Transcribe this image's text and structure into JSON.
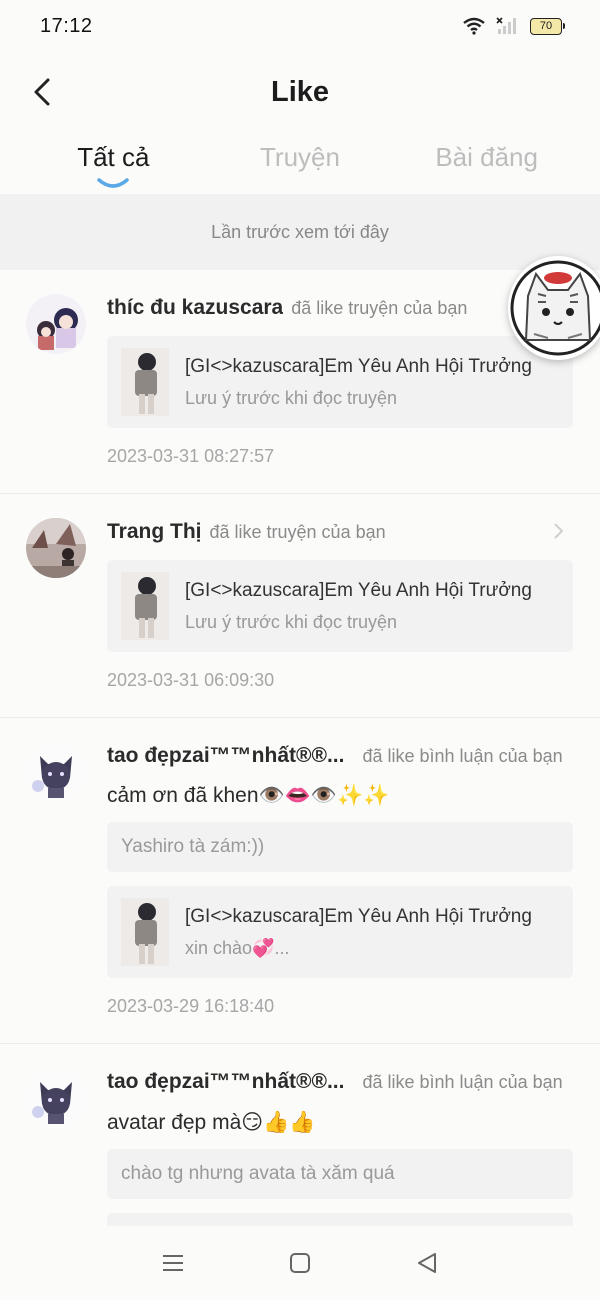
{
  "status_bar": {
    "time": "17:12",
    "battery": "70"
  },
  "header": {
    "title": "Like",
    "back_icon": "chevron-left-icon"
  },
  "tabs": [
    {
      "label": "Tất cả",
      "active": true
    },
    {
      "label": "Truyện",
      "active": false
    },
    {
      "label": "Bài đăng",
      "active": false
    }
  ],
  "notice": "Lần trước xem tới đây",
  "items": [
    {
      "user": "thíc đu kazuscara",
      "action": "đã like truyện của bạn",
      "story_title": "[GI<>kazuscara]Em Yêu Anh Hội Trưởng",
      "story_sub": "Lưu ý trước khi đọc truyện",
      "timestamp": "2023-03-31 08:27:57"
    },
    {
      "user": "Trang Thị",
      "action": "đã like truyện của bạn",
      "story_title": "[GI<>kazuscara]Em Yêu Anh Hội Trưởng",
      "story_sub": "Lưu ý trước khi đọc truyện",
      "timestamp": "2023-03-31 06:09:30"
    },
    {
      "user": "tao đẹpzai™™nhất®®...",
      "action": "đã like bình luận của bạn",
      "comment": "cảm ơn đã khen👁️👄👁️✨✨",
      "quote": "Yashiro tà zám:))",
      "story_title": "[GI<>kazuscara]Em Yêu Anh Hội Trưởng",
      "story_sub": "xin chào💞...",
      "timestamp": "2023-03-29 16:18:40"
    },
    {
      "user": "tao đẹpzai™™nhất®®...",
      "action": "đã like bình luận của bạn",
      "comment": "avatar đẹp mà😏👍👍",
      "quote": "chào tg nhưng avata tà xăm quá"
    }
  ],
  "colors": {
    "accent": "#5aa9e6",
    "muted": "#a6a6a6",
    "card": "#f2f2f2"
  }
}
